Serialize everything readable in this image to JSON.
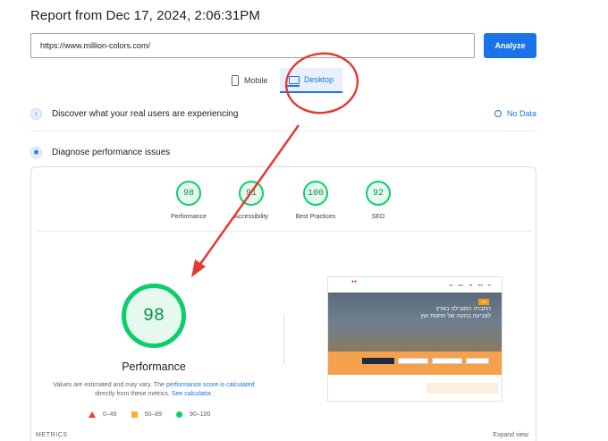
{
  "report": {
    "title": "Report from Dec 17, 2024, 2:06:31PM"
  },
  "url_bar": {
    "value": "https://www.million-colors.com/",
    "analyze_label": "Analyze"
  },
  "tabs": [
    {
      "label": "Mobile",
      "icon": "phone-icon",
      "selected": false
    },
    {
      "label": "Desktop",
      "icon": "monitor-icon",
      "selected": true
    }
  ],
  "discover": {
    "label": "Discover what your real users are experiencing",
    "status": "No Data"
  },
  "diagnose": {
    "label": "Diagnose performance issues"
  },
  "scores": [
    {
      "label": "Performance",
      "value": "98"
    },
    {
      "label": "Accessibility",
      "value": "91"
    },
    {
      "label": "Best Practices",
      "value": "100"
    },
    {
      "label": "SEO",
      "value": "92"
    }
  ],
  "main_score": {
    "value": "98",
    "label": "Performance"
  },
  "note": {
    "text1": "Values are estimated and may vary. The ",
    "link1": "performance score is calculated",
    "text2": " directly from these metrics. ",
    "link2": "See calculator."
  },
  "legend": [
    {
      "range": "0–49",
      "color": "#ff3333",
      "shape": "triangle"
    },
    {
      "range": "50–89",
      "color": "#ffaa33",
      "shape": "square"
    },
    {
      "range": "90–100",
      "color": "#0cce6b",
      "shape": "circle"
    }
  ],
  "metrics": {
    "label": "METRICS",
    "expand_label": "Expand view"
  },
  "preview": {
    "hero_line1": "החברה המובילה בארץ",
    "hero_line2": "לצביעה בהטה של חתנות ועץ"
  },
  "colors": {
    "accent": "#1a73e8",
    "pass": "#0cce6b",
    "annotation": "#e53935"
  }
}
